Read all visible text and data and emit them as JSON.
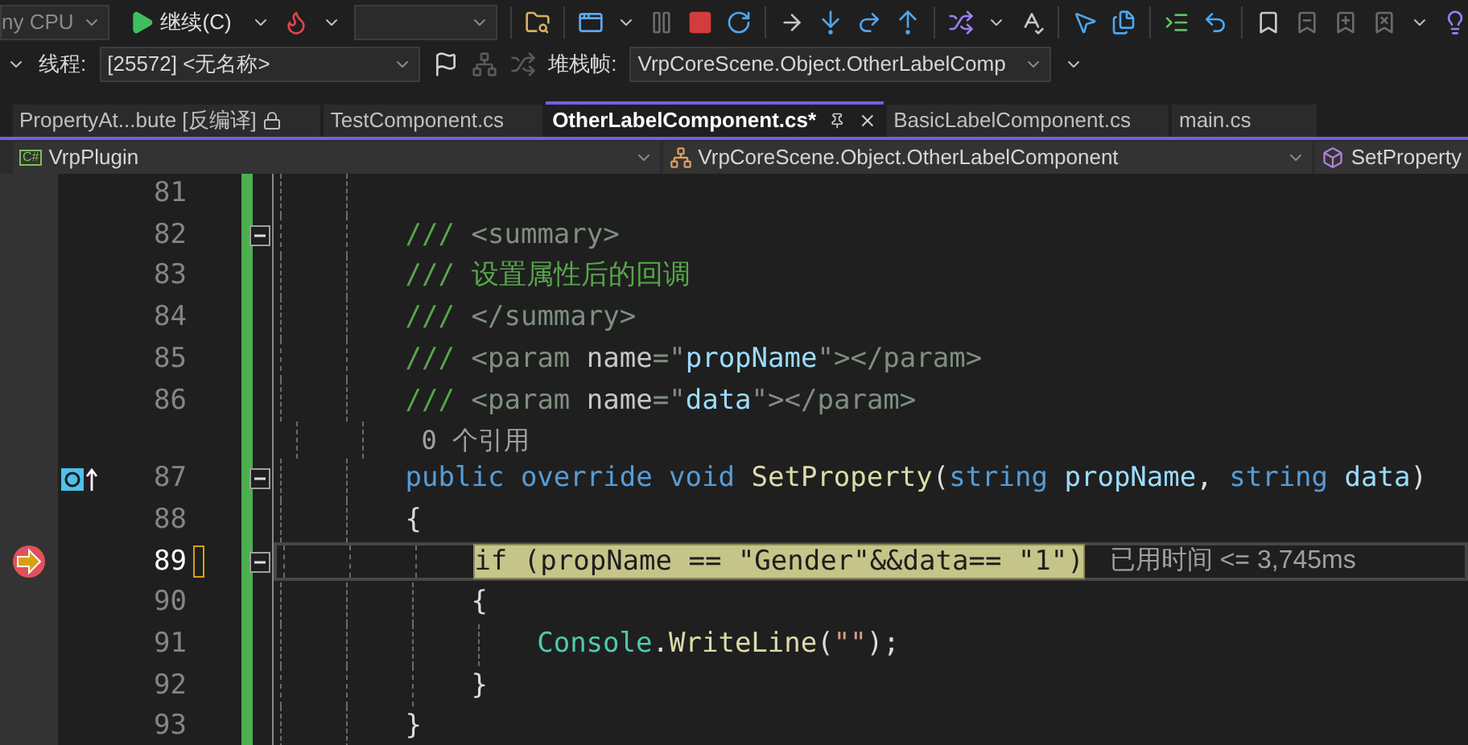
{
  "toolbar": {
    "platform": "ny CPU",
    "continue_button": "继续(C)"
  },
  "debug_location": {
    "thread_label": "线程:",
    "thread": "[25572] <无名称>",
    "stack_frame_label": "堆栈帧:",
    "stack_frame": "VrpCoreScene.Object.OtherLabelComp"
  },
  "tabs": [
    {
      "label": "PropertyAt...bute [反编译]",
      "selected": false,
      "locked": true
    },
    {
      "label": "TestComponent.cs",
      "selected": false,
      "locked": false
    },
    {
      "label": "OtherLabelComponent.cs*",
      "selected": true,
      "locked": false
    },
    {
      "label": "BasicLabelComponent.cs",
      "selected": false,
      "locked": false
    },
    {
      "label": "main.cs",
      "selected": false,
      "locked": false
    }
  ],
  "navigation_bar": {
    "project_icon": "C#",
    "project": "VrpPlugin",
    "type": "VrpCoreScene.Object.OtherLabelComponent",
    "member": "SetProperty"
  },
  "editor": {
    "lines": [
      {
        "kind": "code",
        "number": "81",
        "current": false,
        "foldable": false,
        "execution_pointer": false,
        "method_marker": false
      },
      {
        "kind": "code",
        "number": "82",
        "current": false,
        "foldable": true,
        "execution_pointer": false,
        "method_marker": false,
        "tokens": [
          {
            "text": "/// ",
            "kind": "comment"
          },
          {
            "text": "<summary>",
            "kind": "doc-tag"
          }
        ]
      },
      {
        "kind": "code",
        "number": "83",
        "current": false,
        "foldable": false,
        "execution_pointer": false,
        "method_marker": false,
        "tokens": [
          {
            "text": "/// ",
            "kind": "comment"
          },
          {
            "text": "设置属性后的回调",
            "kind": "doc-text"
          }
        ]
      },
      {
        "kind": "code",
        "number": "84",
        "current": false,
        "foldable": false,
        "execution_pointer": false,
        "method_marker": false,
        "tokens": [
          {
            "text": "/// ",
            "kind": "comment"
          },
          {
            "text": "</summary>",
            "kind": "doc-tag"
          }
        ]
      },
      {
        "kind": "code",
        "number": "85",
        "current": false,
        "foldable": false,
        "execution_pointer": false,
        "method_marker": false,
        "tokens": [
          {
            "text": "/// ",
            "kind": "comment"
          },
          {
            "text": "<param ",
            "kind": "doc-tag"
          },
          {
            "text": "name",
            "kind": "doc-attr"
          },
          {
            "text": "=\"",
            "kind": "doc-tag"
          },
          {
            "text": "propName",
            "kind": "doc-value"
          },
          {
            "text": "\"></param>",
            "kind": "doc-tag"
          }
        ]
      },
      {
        "kind": "code",
        "number": "86",
        "current": false,
        "foldable": false,
        "execution_pointer": false,
        "method_marker": false,
        "tokens": [
          {
            "text": "/// ",
            "kind": "comment"
          },
          {
            "text": "<param ",
            "kind": "doc-tag"
          },
          {
            "text": "name",
            "kind": "doc-attr"
          },
          {
            "text": "=\"",
            "kind": "doc-tag"
          },
          {
            "text": "data",
            "kind": "doc-value"
          },
          {
            "text": "\"></param>",
            "kind": "doc-tag"
          }
        ]
      },
      {
        "kind": "codelens",
        "text": "0 个引用"
      },
      {
        "kind": "code",
        "number": "87",
        "current": false,
        "foldable": true,
        "execution_pointer": false,
        "method_marker": true,
        "tokens": [
          {
            "text": "public override void ",
            "kind": "keyword"
          },
          {
            "text": "SetProperty",
            "kind": "method"
          },
          {
            "text": "(",
            "kind": "plain"
          },
          {
            "text": "string ",
            "kind": "keyword"
          },
          {
            "text": "propName",
            "kind": "param"
          },
          {
            "text": ", ",
            "kind": "plain"
          },
          {
            "text": "string ",
            "kind": "keyword"
          },
          {
            "text": "data",
            "kind": "param"
          },
          {
            "text": ")",
            "kind": "plain"
          }
        ]
      },
      {
        "kind": "code",
        "number": "88",
        "current": false,
        "foldable": false,
        "execution_pointer": false,
        "method_marker": false,
        "tokens": [
          {
            "text": "{",
            "kind": "plain"
          }
        ],
        "children": [
          {
            "kind": "code",
            "number": "89",
            "current": true,
            "foldable": true,
            "execution_pointer": true,
            "method_marker": false,
            "tokens": [
              {
                "text": "if (propName == \"Gender\"&&data== \"1\")",
                "kind": "current-statement"
              }
            ],
            "perf_tip": "已用时间 <= 3,745ms"
          },
          {
            "kind": "code",
            "number": "90",
            "current": false,
            "foldable": false,
            "execution_pointer": false,
            "method_marker": false,
            "tokens": [
              {
                "text": "{",
                "kind": "plain"
              }
            ],
            "children": [
              {
                "kind": "code",
                "number": "91",
                "current": false,
                "foldable": false,
                "execution_pointer": false,
                "method_marker": false,
                "tokens": [
                  {
                    "text": "Console",
                    "kind": "type"
                  },
                  {
                    "text": ".",
                    "kind": "plain"
                  },
                  {
                    "text": "WriteLine",
                    "kind": "method"
                  },
                  {
                    "text": "(",
                    "kind": "plain"
                  },
                  {
                    "text": "\"\"",
                    "kind": "string"
                  },
                  {
                    "text": ");",
                    "kind": "plain"
                  }
                ]
              }
            ]
          },
          {
            "kind": "code",
            "number": "92",
            "current": false,
            "foldable": false,
            "execution_pointer": false,
            "method_marker": false,
            "tokens": [
              {
                "text": "}",
                "kind": "plain"
              }
            ]
          }
        ]
      },
      {
        "kind": "code",
        "number": "93",
        "current": false,
        "foldable": false,
        "execution_pointer": false,
        "method_marker": false,
        "tokens": [
          {
            "text": "}",
            "kind": "plain"
          }
        ]
      }
    ]
  }
}
